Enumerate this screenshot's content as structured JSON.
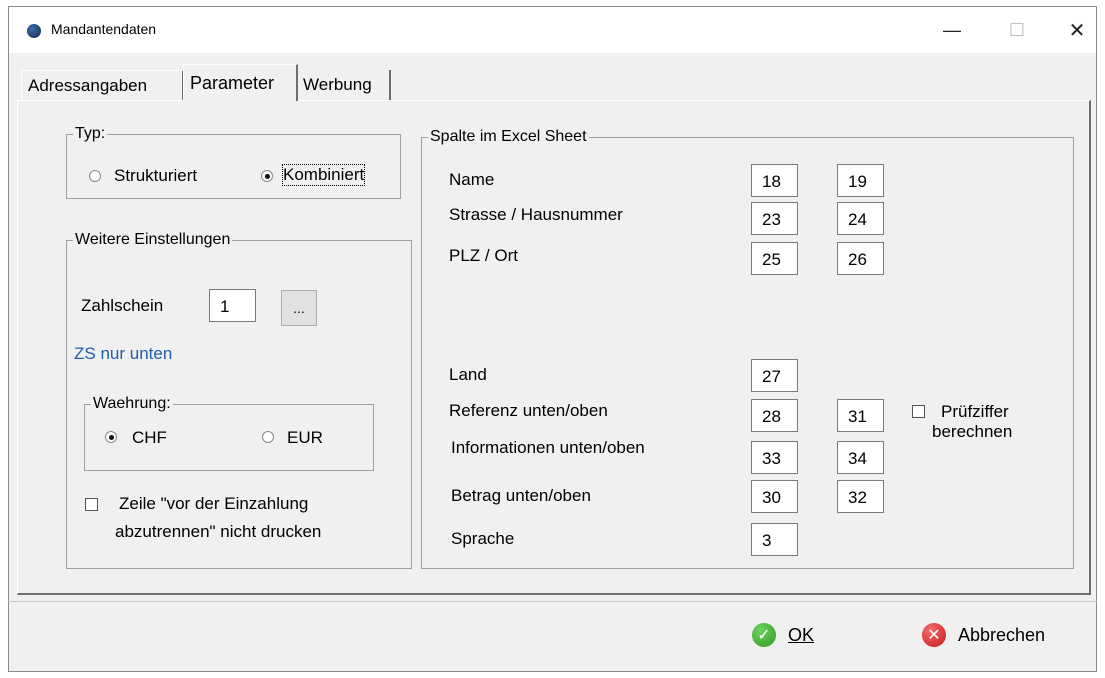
{
  "window": {
    "title": "Mandantendaten",
    "minimize_glyph": "—",
    "maximize_glyph": "☐",
    "close_glyph": "✕"
  },
  "tabs": [
    {
      "label": "Adressangaben",
      "active": false
    },
    {
      "label": "Parameter",
      "active": true
    },
    {
      "label": "Werbung",
      "active": false
    }
  ],
  "typ": {
    "legend": "Typ:",
    "options": [
      {
        "label": "Strukturiert",
        "selected": false
      },
      {
        "label": "Kombiniert",
        "selected": true
      }
    ]
  },
  "weitere": {
    "legend": "Weitere Einstellungen",
    "zahlschein_label": "Zahlschein",
    "zahlschein_value": "1",
    "browse_label": "...",
    "zs_info": "ZS nur unten",
    "waehrung": {
      "legend": "Waehrung:",
      "options": [
        {
          "label": "CHF",
          "selected": true
        },
        {
          "label": "EUR",
          "selected": false
        }
      ]
    },
    "zeile_checkbox_label_line1": "Zeile \"vor der Einzahlung",
    "zeile_checkbox_label_line2": "abzutrennen\" nicht drucken",
    "zeile_checked": false
  },
  "excel": {
    "legend": "Spalte im Excel Sheet",
    "rows": [
      {
        "label": "Name",
        "col1": "18",
        "col2": "19"
      },
      {
        "label": "Strasse / Hausnummer",
        "col1": "23",
        "col2": "24"
      },
      {
        "label": "PLZ / Ort",
        "col1": "25",
        "col2": "26"
      },
      {
        "label": "Land",
        "col1": "27",
        "col2": ""
      },
      {
        "label": "Referenz unten/oben",
        "col1": "28",
        "col2": "31"
      },
      {
        "label": "Informationen unten/oben",
        "col1": "33",
        "col2": "34"
      },
      {
        "label": "Betrag unten/oben",
        "col1": "30",
        "col2": "32"
      },
      {
        "label": "Sprache",
        "col1": "3",
        "col2": ""
      }
    ],
    "pruefziffer_line1": "Prüfziffer",
    "pruefziffer_line2": "berechnen",
    "pruefziffer_checked": false
  },
  "buttons": {
    "ok": "OK",
    "cancel": "Abbrechen"
  },
  "colors": {
    "link_blue": "#1f5fa8",
    "ok_green": "#2f9a22",
    "cancel_red": "#c11d1d"
  }
}
